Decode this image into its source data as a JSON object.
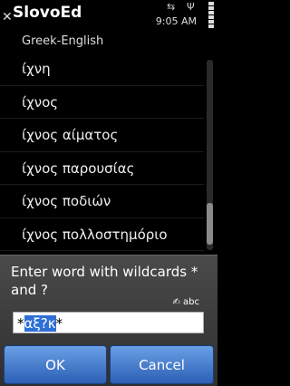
{
  "status": {
    "title": "SlovoEd",
    "time": "9:05 AM",
    "close_glyph": "✕",
    "usb_glyph": "⇆",
    "antenna_glyph": "Ψ"
  },
  "subtitle": "Greek-English",
  "list": [
    "ίχνη",
    "ίχνος",
    "ίχνος αίματος",
    "ίχνος παρουσίας",
    "ίχνος ποδιών",
    "ίχνος πολλοστημόριο"
  ],
  "dialog": {
    "prompt": "Enter word with wildcards * and ?",
    "input_mode": "✍ abc",
    "input": {
      "before": "*",
      "selected": "αξ?κ",
      "after": "*"
    },
    "ok": "OK",
    "cancel": "Cancel"
  },
  "colors": {
    "accent": "#2d6fd6",
    "button": "#3e74c6"
  }
}
